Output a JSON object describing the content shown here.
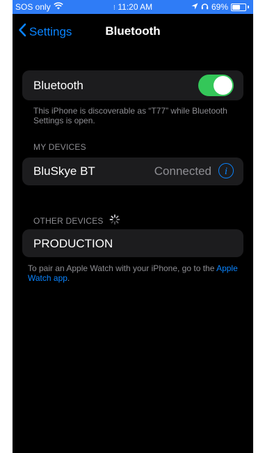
{
  "status_bar": {
    "carrier": "SOS only",
    "time": "11:20 AM",
    "battery": "69%",
    "battery_level": 0.69,
    "icons": [
      "wifi-icon",
      "charging-icon",
      "location-icon",
      "headphones-icon",
      "battery-icon"
    ],
    "background_color": "#2f7cf6"
  },
  "nav": {
    "back_label": "Settings",
    "title": "Bluetooth"
  },
  "bluetooth_row": {
    "label": "Bluetooth",
    "enabled": true,
    "toggle_color": "#34c759"
  },
  "discoverable_text": "This iPhone is discoverable as “T77” while Bluetooth Settings is open.",
  "my_devices": {
    "header": "MY DEVICES",
    "items": [
      {
        "name": "BluSkye BT",
        "status": "Connected"
      }
    ]
  },
  "other_devices": {
    "header": "OTHER DEVICES",
    "items": [
      {
        "name": "PRODUCTION"
      }
    ]
  },
  "pair_footer": {
    "text": "To pair an Apple Watch with your iPhone, go to the",
    "link": "Apple Watch app",
    "suffix": "."
  },
  "accent_color": "#0a84ff"
}
